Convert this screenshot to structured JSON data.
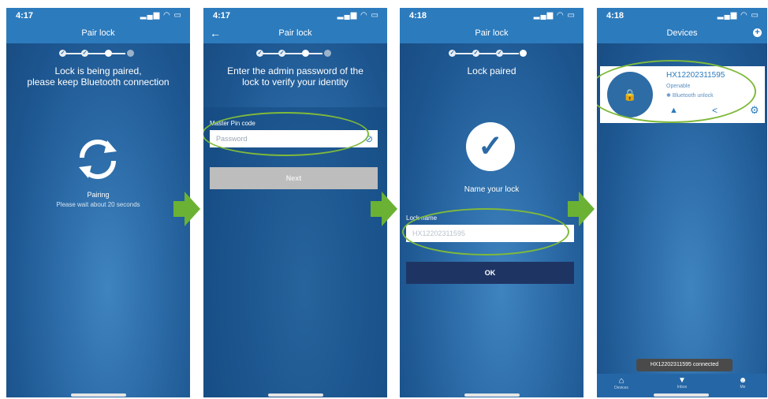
{
  "screens": [
    {
      "time": "4:17",
      "title": "Pair lock",
      "heading_line1": "Lock is being paired,",
      "heading_line2": "please keep Bluetooth connection",
      "status": "Pairing",
      "hint": "Please wait about 20 seconds"
    },
    {
      "time": "4:17",
      "title": "Pair lock",
      "heading_line1": "Enter the admin password of the",
      "heading_line2": "lock to verify your identity",
      "field_label": "Master Pin code",
      "field_placeholder": "Password",
      "button": "Next"
    },
    {
      "time": "4:18",
      "title": "Pair lock",
      "heading": "Lock paired",
      "subheading": "Name your lock",
      "field_label": "Lock name",
      "field_value": "HX12202311595",
      "button": "OK"
    },
    {
      "time": "4:18",
      "title": "Devices",
      "device_name": "HX12202311595",
      "device_status": "Openable",
      "device_unlock": "Bluetooth unlock",
      "toast": "HX12202311595 connected",
      "tabs": [
        "Devices",
        "Inbox",
        "Me"
      ]
    }
  ],
  "colors": {
    "header_blue": "#2c7bbd",
    "screen_blue": "#2b6aa6",
    "highlight_green": "#7fb93a",
    "arrow_green": "#6bb234",
    "ok_button": "#1e3564",
    "next_button": "#bdbdbd"
  },
  "icons": [
    "sync-icon",
    "check-icon",
    "lock-icon",
    "bell-icon",
    "share-icon",
    "gear-icon",
    "home-icon",
    "inbox-icon",
    "me-icon",
    "back-arrow-icon",
    "plus-icon",
    "eye-off-icon"
  ]
}
